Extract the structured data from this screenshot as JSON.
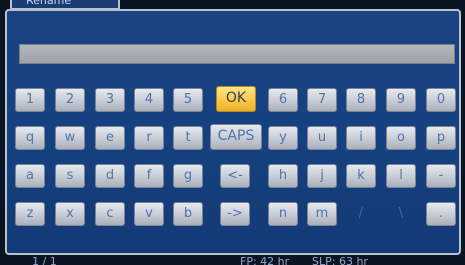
{
  "header": {
    "title": "Rename"
  },
  "input": {
    "value": ""
  },
  "keyboard": {
    "row1": [
      "1",
      "2",
      "3",
      "4",
      "5",
      "OK",
      "6",
      "7",
      "8",
      "9",
      "0"
    ],
    "row2": [
      "q",
      "w",
      "e",
      "r",
      "t",
      "CAPS",
      "y",
      "u",
      "i",
      "o",
      "p"
    ],
    "row3": [
      "a",
      "s",
      "d",
      "f",
      "g",
      "<-",
      "h",
      "j",
      "k",
      "l",
      "-"
    ],
    "row4": [
      "z",
      "x",
      "c",
      "v",
      "b",
      "->",
      "n",
      "m",
      "/",
      "\\",
      "."
    ]
  },
  "selected_key": "OK",
  "footer": {
    "page": "1 / 1",
    "fp": "FP: 42 hr",
    "slp": "SLP: 63 hr"
  },
  "colors": {
    "panel": "#164180",
    "key": "#c9cdd6",
    "key_text": "#4e76a8",
    "selected": "#f9c948"
  }
}
